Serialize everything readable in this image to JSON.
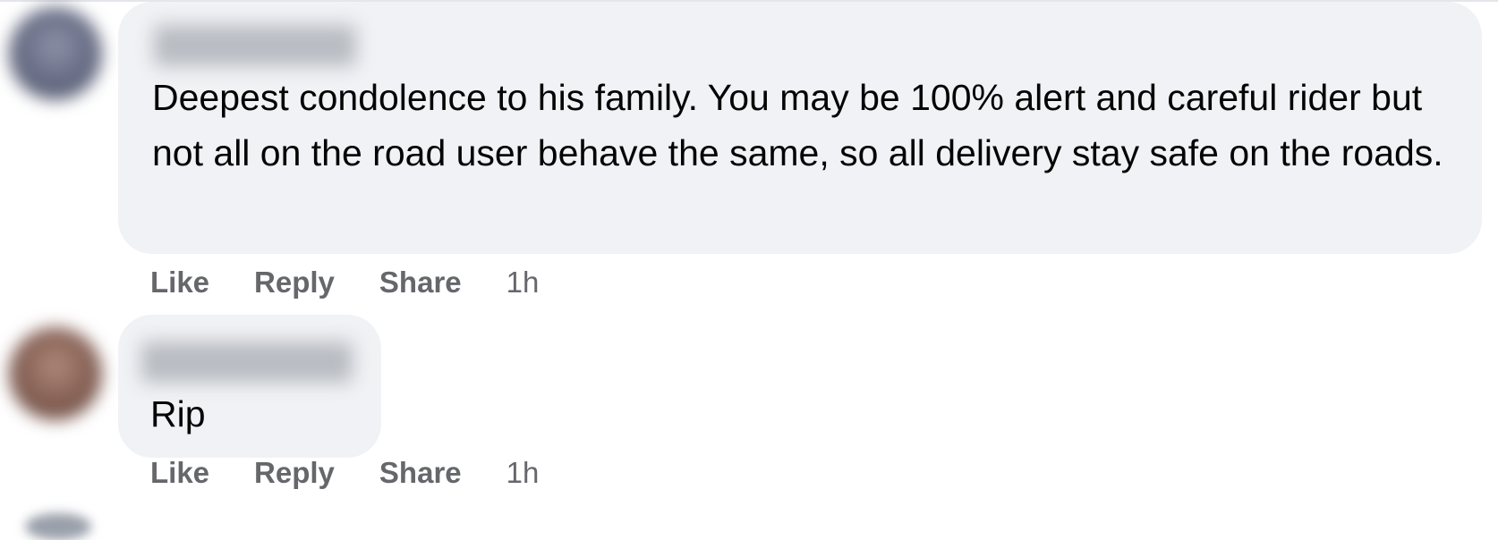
{
  "comments": [
    {
      "author": "",
      "text": "Deepest condolence to his family. You may be 100% alert and careful rider but not all on the road user behave the same, so all delivery stay safe on the roads.",
      "actions": {
        "like": "Like",
        "reply": "Reply",
        "share": "Share"
      },
      "timestamp": "1h"
    },
    {
      "author": "",
      "text": "Rip",
      "actions": {
        "like": "Like",
        "reply": "Reply",
        "share": "Share"
      },
      "timestamp": "1h"
    }
  ]
}
